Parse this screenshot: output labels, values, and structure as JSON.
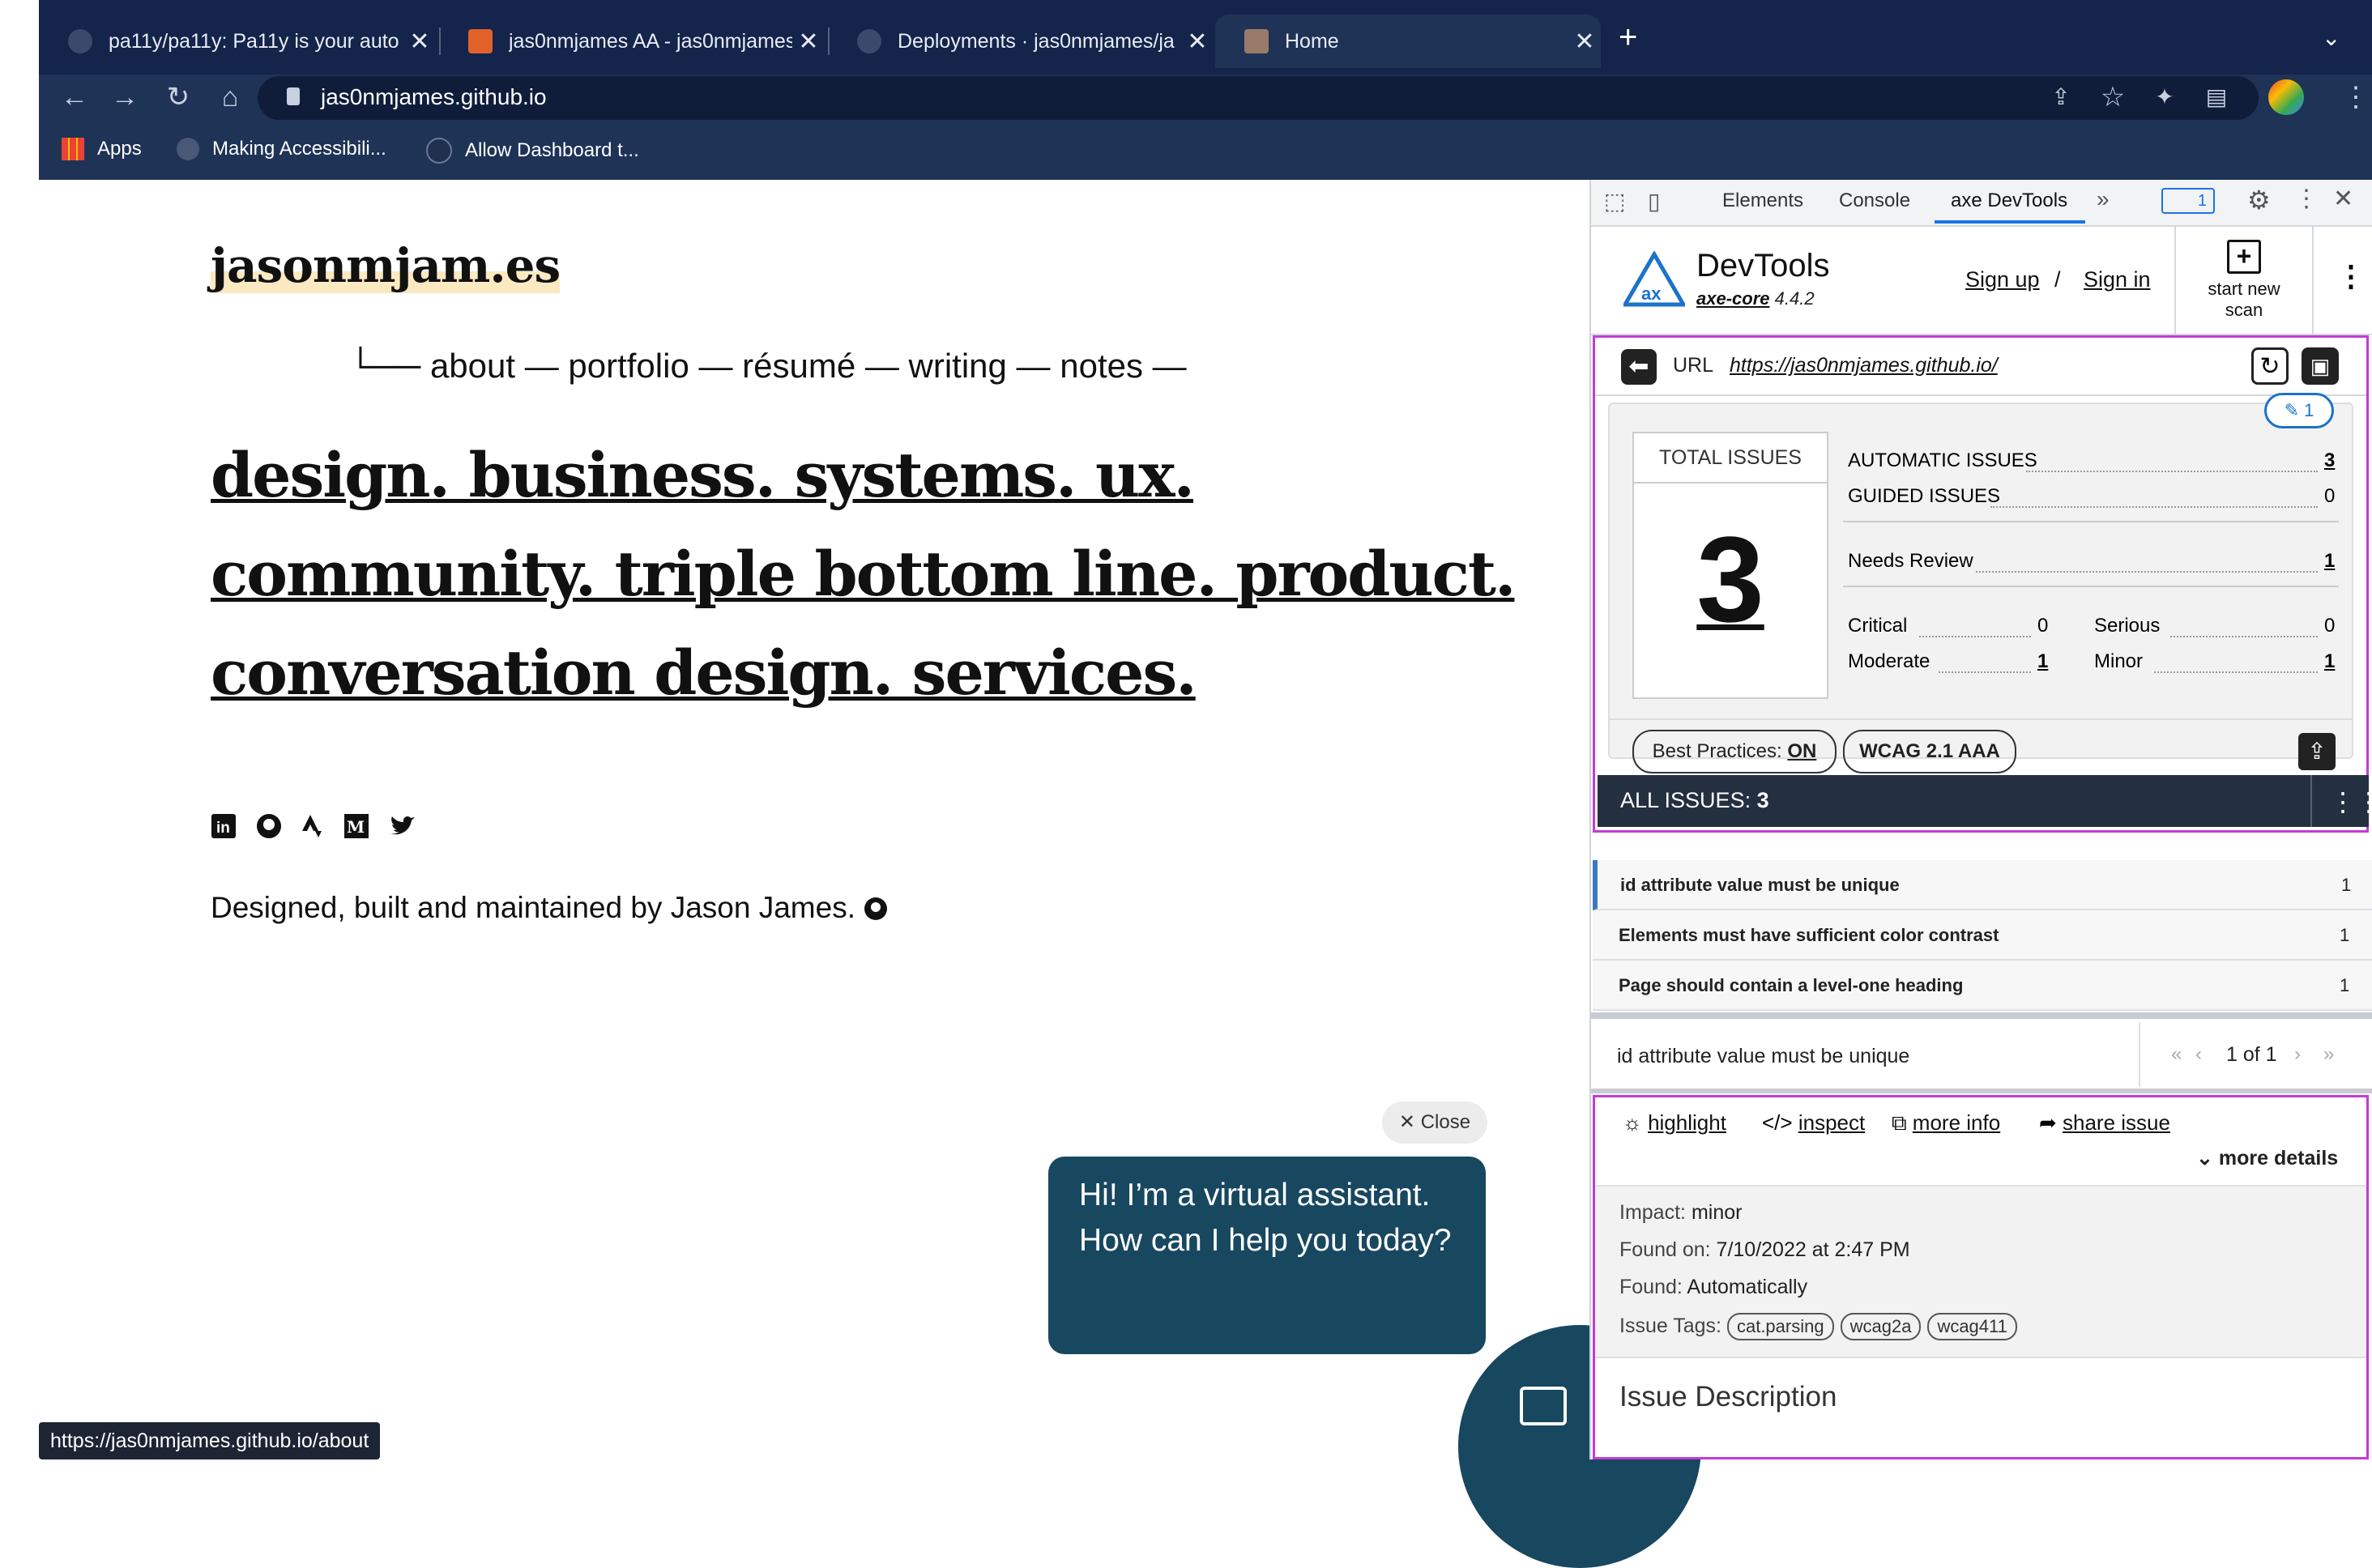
{
  "browser": {
    "tabs": [
      {
        "title": "pa11y/pa11y: Pa11y is your auto"
      },
      {
        "title": "jas0nmjames AA - jas0nmjames"
      },
      {
        "title": "Deployments · jas0nmjames/ja"
      },
      {
        "title": "Home"
      }
    ],
    "url": "jas0nmjames.github.io",
    "bookmarks": [
      "Apps",
      "Making Accessibili...",
      "Allow Dashboard t..."
    ],
    "status_url": "https://jas0nmjames.github.io/about"
  },
  "site": {
    "title": "jasonmjam.es",
    "nav": "└── about — portfolio — résumé — writing — notes —",
    "headlines": [
      "design. business. systems. ux.",
      "community. triple bottom line. product.",
      "conversation design. services."
    ],
    "social_icons": [
      "linkedin-icon",
      "github-icon",
      "strava-icon",
      "medium-icon",
      "twitter-icon"
    ],
    "footer": "Designed, built and maintained by Jason James."
  },
  "chat": {
    "close_label": "Close",
    "message": "Hi! I’m a virtual assistant. How can I help you today?"
  },
  "devtools": {
    "tabs": [
      "Elements",
      "Console",
      "axe DevTools"
    ],
    "badge_count": "1",
    "brand": "DevTools",
    "axe_core_label": "axe-core",
    "axe_core_version": "4.4.2",
    "sign_up": "Sign up",
    "sign_in": "Sign in",
    "start_scan": [
      "start new",
      "scan"
    ],
    "url_label": "URL",
    "scanned_url": "https://jas0nmjames.github.io/",
    "pin_count": "1",
    "total_issues_label": "TOTAL ISSUES",
    "total_issues": "3",
    "automatic_label": "AUTOMATIC ISSUES",
    "automatic": "3",
    "guided_label": "GUIDED ISSUES",
    "guided": "0",
    "needs_review_label": "Needs Review",
    "needs_review": "1",
    "critical_label": "Critical",
    "critical": "0",
    "serious_label": "Serious",
    "serious": "0",
    "moderate_label": "Moderate",
    "moderate": "1",
    "minor_label": "Minor",
    "minor": "1",
    "best_practices_label": "Best Practices:",
    "best_practices_value": "ON",
    "wcag": "WCAG 2.1 AAA",
    "all_issues_label": "ALL ISSUES:",
    "all_issues_count": "3",
    "issues": [
      {
        "name": "id attribute value must be unique",
        "count": "1"
      },
      {
        "name": "Elements must have sufficient color contrast",
        "count": "1"
      },
      {
        "name": "Page should contain a level-one heading",
        "count": "1"
      }
    ],
    "selected_issue": "id attribute value must be unique",
    "pager": "1 of 1",
    "actions": [
      "highlight",
      "inspect",
      "more info",
      "share issue"
    ],
    "more_details": "more details",
    "impact_label": "Impact:",
    "impact": "minor",
    "found_on_label": "Found on:",
    "found_on": "7/10/2022 at 2:47 PM",
    "found_label": "Found:",
    "found": "Automatically",
    "tags_label": "Issue Tags:",
    "tags": [
      "cat.parsing",
      "wcag2a",
      "wcag411"
    ],
    "description_heading": "Issue Description"
  },
  "colors": {
    "chrome_bg": "#1e3356",
    "chat": "#184760",
    "panel_border": "#c43bd6",
    "issues_bar": "#243040"
  }
}
